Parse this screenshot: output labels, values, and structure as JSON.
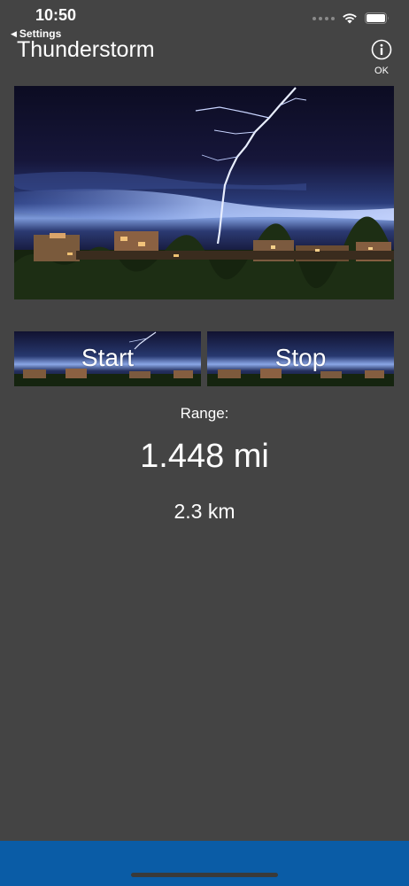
{
  "status_bar": {
    "time": "10:50"
  },
  "nav": {
    "back_label": "Settings",
    "back_glyph": "◀",
    "title": "Thunderstorm",
    "info_label": "OK"
  },
  "buttons": {
    "start_label": "Start",
    "stop_label": "Stop"
  },
  "range": {
    "label": "Range:",
    "miles": "1.448 mi",
    "kilometers": "2.3 km"
  },
  "icons": {
    "back": "chevron-left-icon",
    "info": "info-circle-icon",
    "wifi": "wifi-icon",
    "battery": "battery-icon"
  },
  "colors": {
    "background": "#444444",
    "bottom_bar": "#0a5ca6",
    "text": "#ffffff"
  }
}
